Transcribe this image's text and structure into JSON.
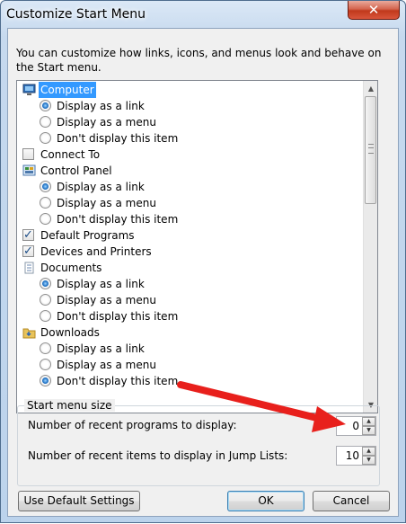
{
  "window": {
    "title": "Customize Start Menu",
    "close_label": "✕"
  },
  "intro": "You can customize how links, icons, and menus look and behave on the Start menu.",
  "tree": [
    {
      "type": "category",
      "icon": "computer-icon",
      "label": "Computer",
      "selected": true
    },
    {
      "type": "radio",
      "label": "Display as a link",
      "checked": true
    },
    {
      "type": "radio",
      "label": "Display as a menu",
      "checked": false
    },
    {
      "type": "radio",
      "label": "Don't display this item",
      "checked": false
    },
    {
      "type": "checkbox",
      "label": "Connect To",
      "checked": false
    },
    {
      "type": "category",
      "icon": "control-panel-icon",
      "label": "Control Panel",
      "selected": false
    },
    {
      "type": "radio",
      "label": "Display as a link",
      "checked": true
    },
    {
      "type": "radio",
      "label": "Display as a menu",
      "checked": false
    },
    {
      "type": "radio",
      "label": "Don't display this item",
      "checked": false
    },
    {
      "type": "checkbox",
      "label": "Default Programs",
      "checked": true
    },
    {
      "type": "checkbox",
      "label": "Devices and Printers",
      "checked": true
    },
    {
      "type": "category",
      "icon": "documents-icon",
      "label": "Documents",
      "selected": false
    },
    {
      "type": "radio",
      "label": "Display as a link",
      "checked": true
    },
    {
      "type": "radio",
      "label": "Display as a menu",
      "checked": false
    },
    {
      "type": "radio",
      "label": "Don't display this item",
      "checked": false
    },
    {
      "type": "category",
      "icon": "downloads-icon",
      "label": "Downloads",
      "selected": false
    },
    {
      "type": "radio",
      "label": "Display as a link",
      "checked": false
    },
    {
      "type": "radio",
      "label": "Display as a menu",
      "checked": false
    },
    {
      "type": "radio",
      "label": "Don't display this item",
      "checked": true
    }
  ],
  "start_menu_size": {
    "title": "Start menu size",
    "recent_programs_label": "Number of recent programs to display:",
    "recent_programs_value": "0",
    "jump_list_label": "Number of recent items to display in Jump Lists:",
    "jump_list_value": "10"
  },
  "buttons": {
    "defaults": "Use Default Settings",
    "ok": "OK",
    "cancel": "Cancel"
  },
  "colors": {
    "annotation_arrow": "#e8201c",
    "selection": "#3399ff"
  }
}
